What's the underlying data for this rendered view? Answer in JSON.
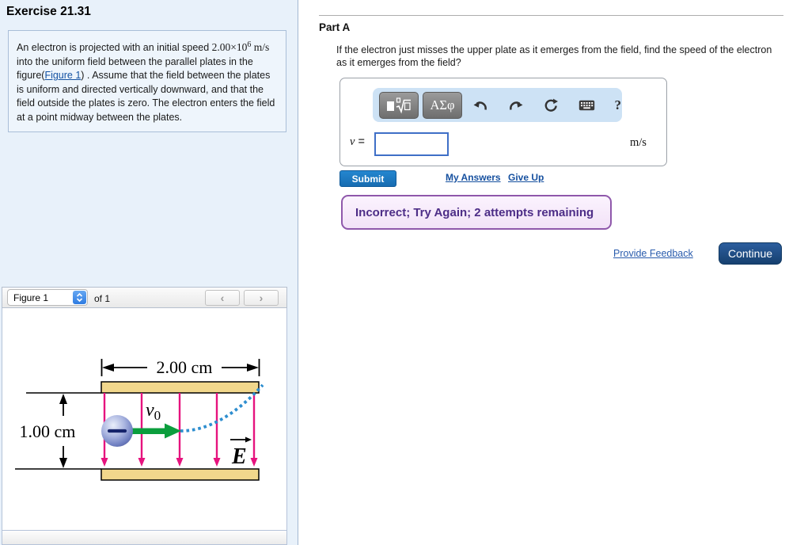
{
  "left_panel": {
    "title": "Exercise 21.31",
    "problem": {
      "t1": "An electron is projected with an initial speed ",
      "speed_coeff": "2.00×10",
      "speed_exp": "6",
      "speed_unit": " m/s",
      "t2": " into the uniform field between the parallel plates in the figure(",
      "figure_link": "Figure 1",
      "t3": ") . Assume that the field between the plates is uniform and directed vertically downward, and that the field outside the plates is zero. The electron enters the field at a point midway between the plates."
    },
    "figure_viewer": {
      "selector_value": "Figure 1",
      "of_label": "of 1",
      "prev_label": "‹",
      "next_label": "›",
      "diagram": {
        "width_label": "2.00 cm",
        "gap_label": "1.00 cm",
        "v_label": "v",
        "v_sub": "0",
        "e_label": "E",
        "colors": {
          "plate": "#f1d78c",
          "field_line": "#e6137e",
          "electron_fill": "#7b89c9",
          "velocity_arrow": "#0b9e3d",
          "trajectory": "#2e8ecf"
        }
      }
    }
  },
  "main": {
    "part_heading": "Part A",
    "question": "If the electron just misses the upper plate as it emerges from the field, find the speed of the electron as it emerges from the field?",
    "answer_widget": {
      "greek_button_label": "ΑΣφ",
      "help_label": "?",
      "var_label": "v",
      "equals_label": " = ",
      "input_value": "",
      "unit_label": "m/s",
      "icons": {
        "templates_button": "math-templates-icon",
        "undo": "undo-icon",
        "redo": "redo-icon",
        "reset": "reset-icon",
        "keyboard": "keyboard-icon"
      }
    },
    "submit_label": "Submit",
    "my_answers_label": "My Answers",
    "give_up_label": "Give Up",
    "feedback_message": "Incorrect; Try Again; 2 attempts remaining",
    "provide_feedback_label": "Provide Feedback",
    "continue_label": "Continue"
  }
}
